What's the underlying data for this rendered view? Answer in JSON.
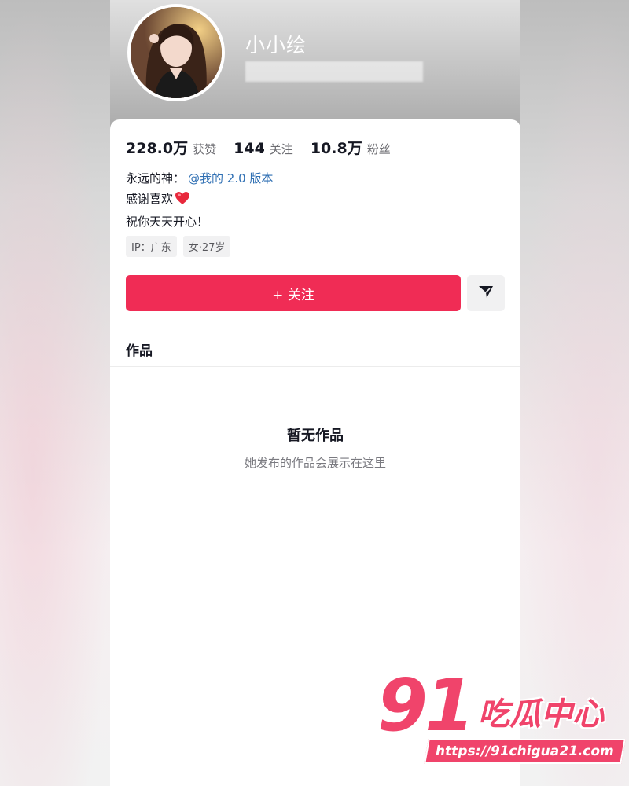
{
  "profile": {
    "nickname": "小小绘",
    "avatar_icon": "profile-photo"
  },
  "stats": [
    {
      "value": "228.0万",
      "label": "获赞"
    },
    {
      "value": "144",
      "label": "关注"
    },
    {
      "value": "10.8万",
      "label": "粉丝"
    }
  ],
  "bio": {
    "line1_prefix": "永远的神：",
    "line1_mention": "@我的 2.0 版本",
    "line2": "感谢喜欢",
    "line2_emoji": "heart-icon",
    "line3": "祝你天天开心！"
  },
  "tags": [
    "IP：广东",
    "女·27岁"
  ],
  "actions": {
    "follow_label": "+ 关注",
    "share_icon": "send-icon",
    "accent_color": "#f02c55"
  },
  "works": {
    "tab_label": "作品",
    "empty_title": "暂无作品",
    "empty_subtitle": "她发布的作品会展示在这里"
  },
  "watermark": {
    "number": "91",
    "brand": "吃瓜中心",
    "url": "https://91chigua21.com",
    "color": "#f0446b"
  }
}
